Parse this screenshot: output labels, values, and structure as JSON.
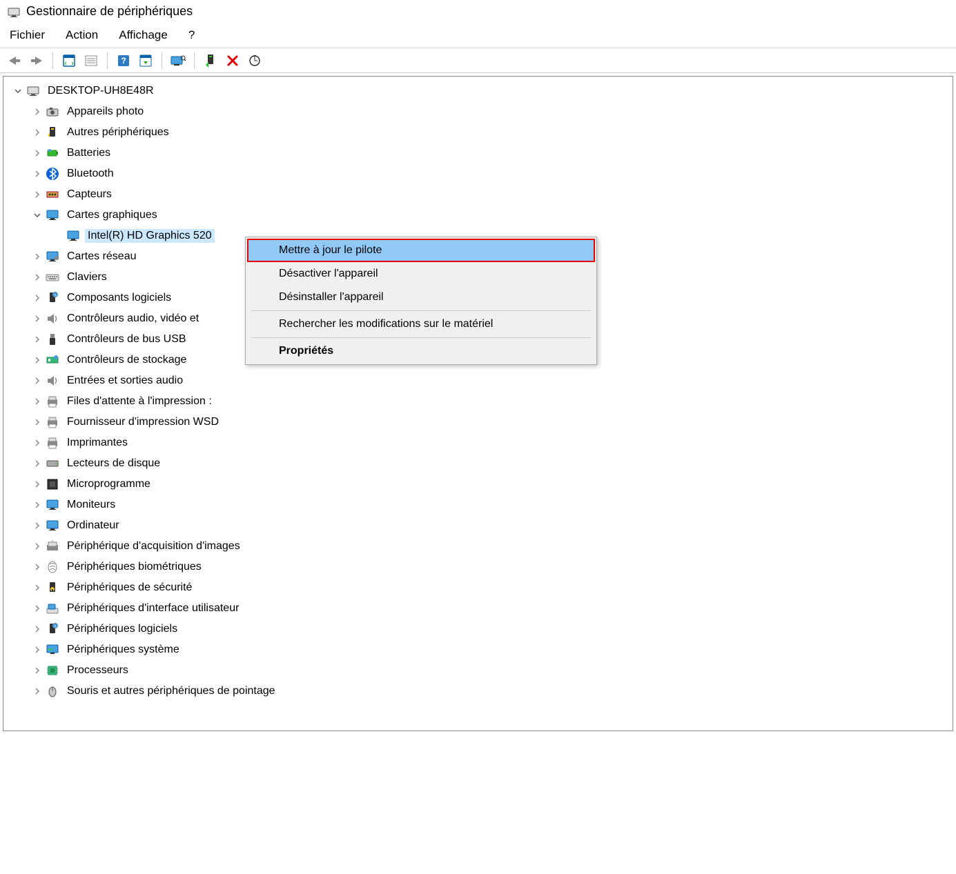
{
  "window": {
    "title": "Gestionnaire de périphériques"
  },
  "menu": {
    "file": "Fichier",
    "action": "Action",
    "view": "Affichage",
    "help": "?"
  },
  "toolbar_icons": [
    "back",
    "forward",
    "properties-frame",
    "list",
    "help",
    "show",
    "monitor",
    "add",
    "delete",
    "scan"
  ],
  "tree": {
    "root": {
      "label": "DESKTOP-UH8E48R",
      "icon": "computer",
      "expanded": true
    },
    "categories": [
      {
        "icon": "camera",
        "label": "Appareils photo"
      },
      {
        "icon": "other",
        "label": "Autres périphériques"
      },
      {
        "icon": "battery",
        "label": "Batteries"
      },
      {
        "icon": "bluetooth",
        "label": "Bluetooth"
      },
      {
        "icon": "sensor",
        "label": "Capteurs"
      },
      {
        "icon": "display",
        "label": "Cartes graphiques",
        "expanded": true,
        "children": [
          {
            "icon": "display",
            "label": "Intel(R) HD Graphics 520",
            "selected": true
          }
        ]
      },
      {
        "icon": "network",
        "label": "Cartes réseau"
      },
      {
        "icon": "keyboard",
        "label": "Claviers"
      },
      {
        "icon": "software",
        "label": "Composants logiciels"
      },
      {
        "icon": "audio",
        "label": "Contrôleurs audio, vidéo et"
      },
      {
        "icon": "usb",
        "label": "Contrôleurs de bus USB"
      },
      {
        "icon": "storage",
        "label": "Contrôleurs de stockage"
      },
      {
        "icon": "audio",
        "label": "Entrées et sorties audio"
      },
      {
        "icon": "printer",
        "label": "Files d'attente à l'impression :"
      },
      {
        "icon": "printer",
        "label": "Fournisseur d'impression WSD"
      },
      {
        "icon": "printer",
        "label": "Imprimantes"
      },
      {
        "icon": "disk",
        "label": "Lecteurs de disque"
      },
      {
        "icon": "firmware",
        "label": "Microprogramme"
      },
      {
        "icon": "monitor",
        "label": "Moniteurs"
      },
      {
        "icon": "computer",
        "label": "Ordinateur"
      },
      {
        "icon": "imaging",
        "label": "Périphérique d'acquisition d'images"
      },
      {
        "icon": "biometric",
        "label": "Périphériques biométriques"
      },
      {
        "icon": "security",
        "label": "Périphériques de sécurité"
      },
      {
        "icon": "hid",
        "label": "Périphériques d'interface utilisateur"
      },
      {
        "icon": "software",
        "label": "Périphériques logiciels"
      },
      {
        "icon": "system",
        "label": "Périphériques système"
      },
      {
        "icon": "cpu",
        "label": "Processeurs"
      },
      {
        "icon": "mouse",
        "label": "Souris et autres périphériques de pointage"
      }
    ]
  },
  "context_menu": {
    "items": [
      {
        "label": "Mettre à jour le pilote",
        "highlighted": true
      },
      {
        "label": "Désactiver l'appareil"
      },
      {
        "label": "Désinstaller l'appareil"
      },
      {
        "sep": true
      },
      {
        "label": "Rechercher les modifications sur le matériel"
      },
      {
        "sep": true
      },
      {
        "label": "Propriétés",
        "bold": true
      }
    ]
  }
}
